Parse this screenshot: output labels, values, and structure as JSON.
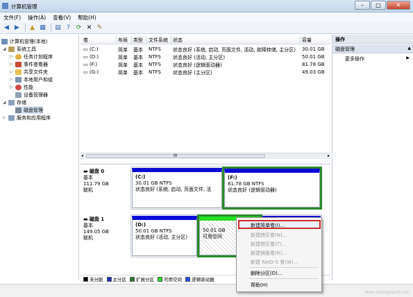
{
  "window": {
    "title": "计算机管理",
    "buttons": {
      "minimize": "–",
      "maximize": "□",
      "close": "✕"
    }
  },
  "menu": [
    "文件(F)",
    "操作(A)",
    "查看(V)",
    "帮助(H)"
  ],
  "tree": {
    "root": "计算机管理(本地)",
    "system_tools": "系统工具",
    "task_scheduler": "任务计划程序",
    "event_viewer": "事件查看器",
    "shared_folders": "共享文件夹",
    "local_users": "本地用户和组",
    "performance": "性能",
    "device_manager": "设备管理器",
    "storage": "存储",
    "disk_management": "磁盘管理",
    "services": "服务和应用程序"
  },
  "volume_table": {
    "headers": [
      "卷",
      "布局",
      "类型",
      "文件系统",
      "状态",
      "容量"
    ],
    "rows": [
      [
        "(C:)",
        "简单",
        "基本",
        "NTFS",
        "状态良好 (系统, 启动, 页面文件, 活动, 故障转储, 主分区)",
        "30.01 GB"
      ],
      [
        "(D:)",
        "简单",
        "基本",
        "NTFS",
        "状态良好 (活动, 主分区)",
        "50.01 GB"
      ],
      [
        "(F:)",
        "简单",
        "基本",
        "NTFS",
        "状态良好 (逻辑驱动器)",
        "81.78 GB"
      ],
      [
        "(G:)",
        "简单",
        "基本",
        "NTFS",
        "状态良好 (主分区)",
        "49.03 GB"
      ]
    ]
  },
  "scroll_glyph": "III",
  "disks": [
    {
      "name": "磁盘 0",
      "type": "基本",
      "size": "111.79 GB",
      "state": "联机",
      "partitions": [
        {
          "name": "(C:)",
          "size": "30.01 GB NTFS",
          "status": "状态良好 (系统, 启动, 页面文件, 活",
          "bar": "#0000e0"
        },
        {
          "name": "(F:)",
          "size": "81.78 GB NTFS",
          "status": "状态良好 (逻辑驱动器)",
          "bar": "#0000e0"
        }
      ]
    },
    {
      "name": "磁盘 1",
      "type": "基本",
      "size": "149.05 GB",
      "state": "联机",
      "partitions": [
        {
          "name": "(D:)",
          "size": "50.01 GB NTFS",
          "status": "状态良好 (活动, 主分区)",
          "bar": "#0000e0"
        },
        {
          "name": "",
          "size": "50.01 GB",
          "status": "可用空间",
          "bar": "#25e025"
        }
      ]
    }
  ],
  "legend": [
    {
      "label": "未分配",
      "color": "#000000"
    },
    {
      "label": "主分区",
      "color": "#1c2fb8"
    },
    {
      "label": "扩展分区",
      "color": "#2e7d2e"
    },
    {
      "label": "可用空间",
      "color": "#25e025"
    },
    {
      "label": "逻辑驱动器",
      "color": "#2050ff"
    }
  ],
  "actions": {
    "header": "操作",
    "section": "磁盘管理",
    "item": "更多操作"
  },
  "context_menu": [
    {
      "label": "新建简单卷(I)...",
      "enabled": true
    },
    {
      "label": "新建跨区卷(N)...",
      "enabled": false
    },
    {
      "label": "新建带区卷(T)...",
      "enabled": false
    },
    {
      "label": "新建镜像卷(R)...",
      "enabled": false
    },
    {
      "label": "新建 RAID-5 卷(W)...",
      "enabled": false
    },
    {
      "label": "删除分区(D)...",
      "enabled": true
    },
    {
      "label": "帮助(H)",
      "enabled": true
    }
  ],
  "watermark": "www.xitongtiandi.net"
}
